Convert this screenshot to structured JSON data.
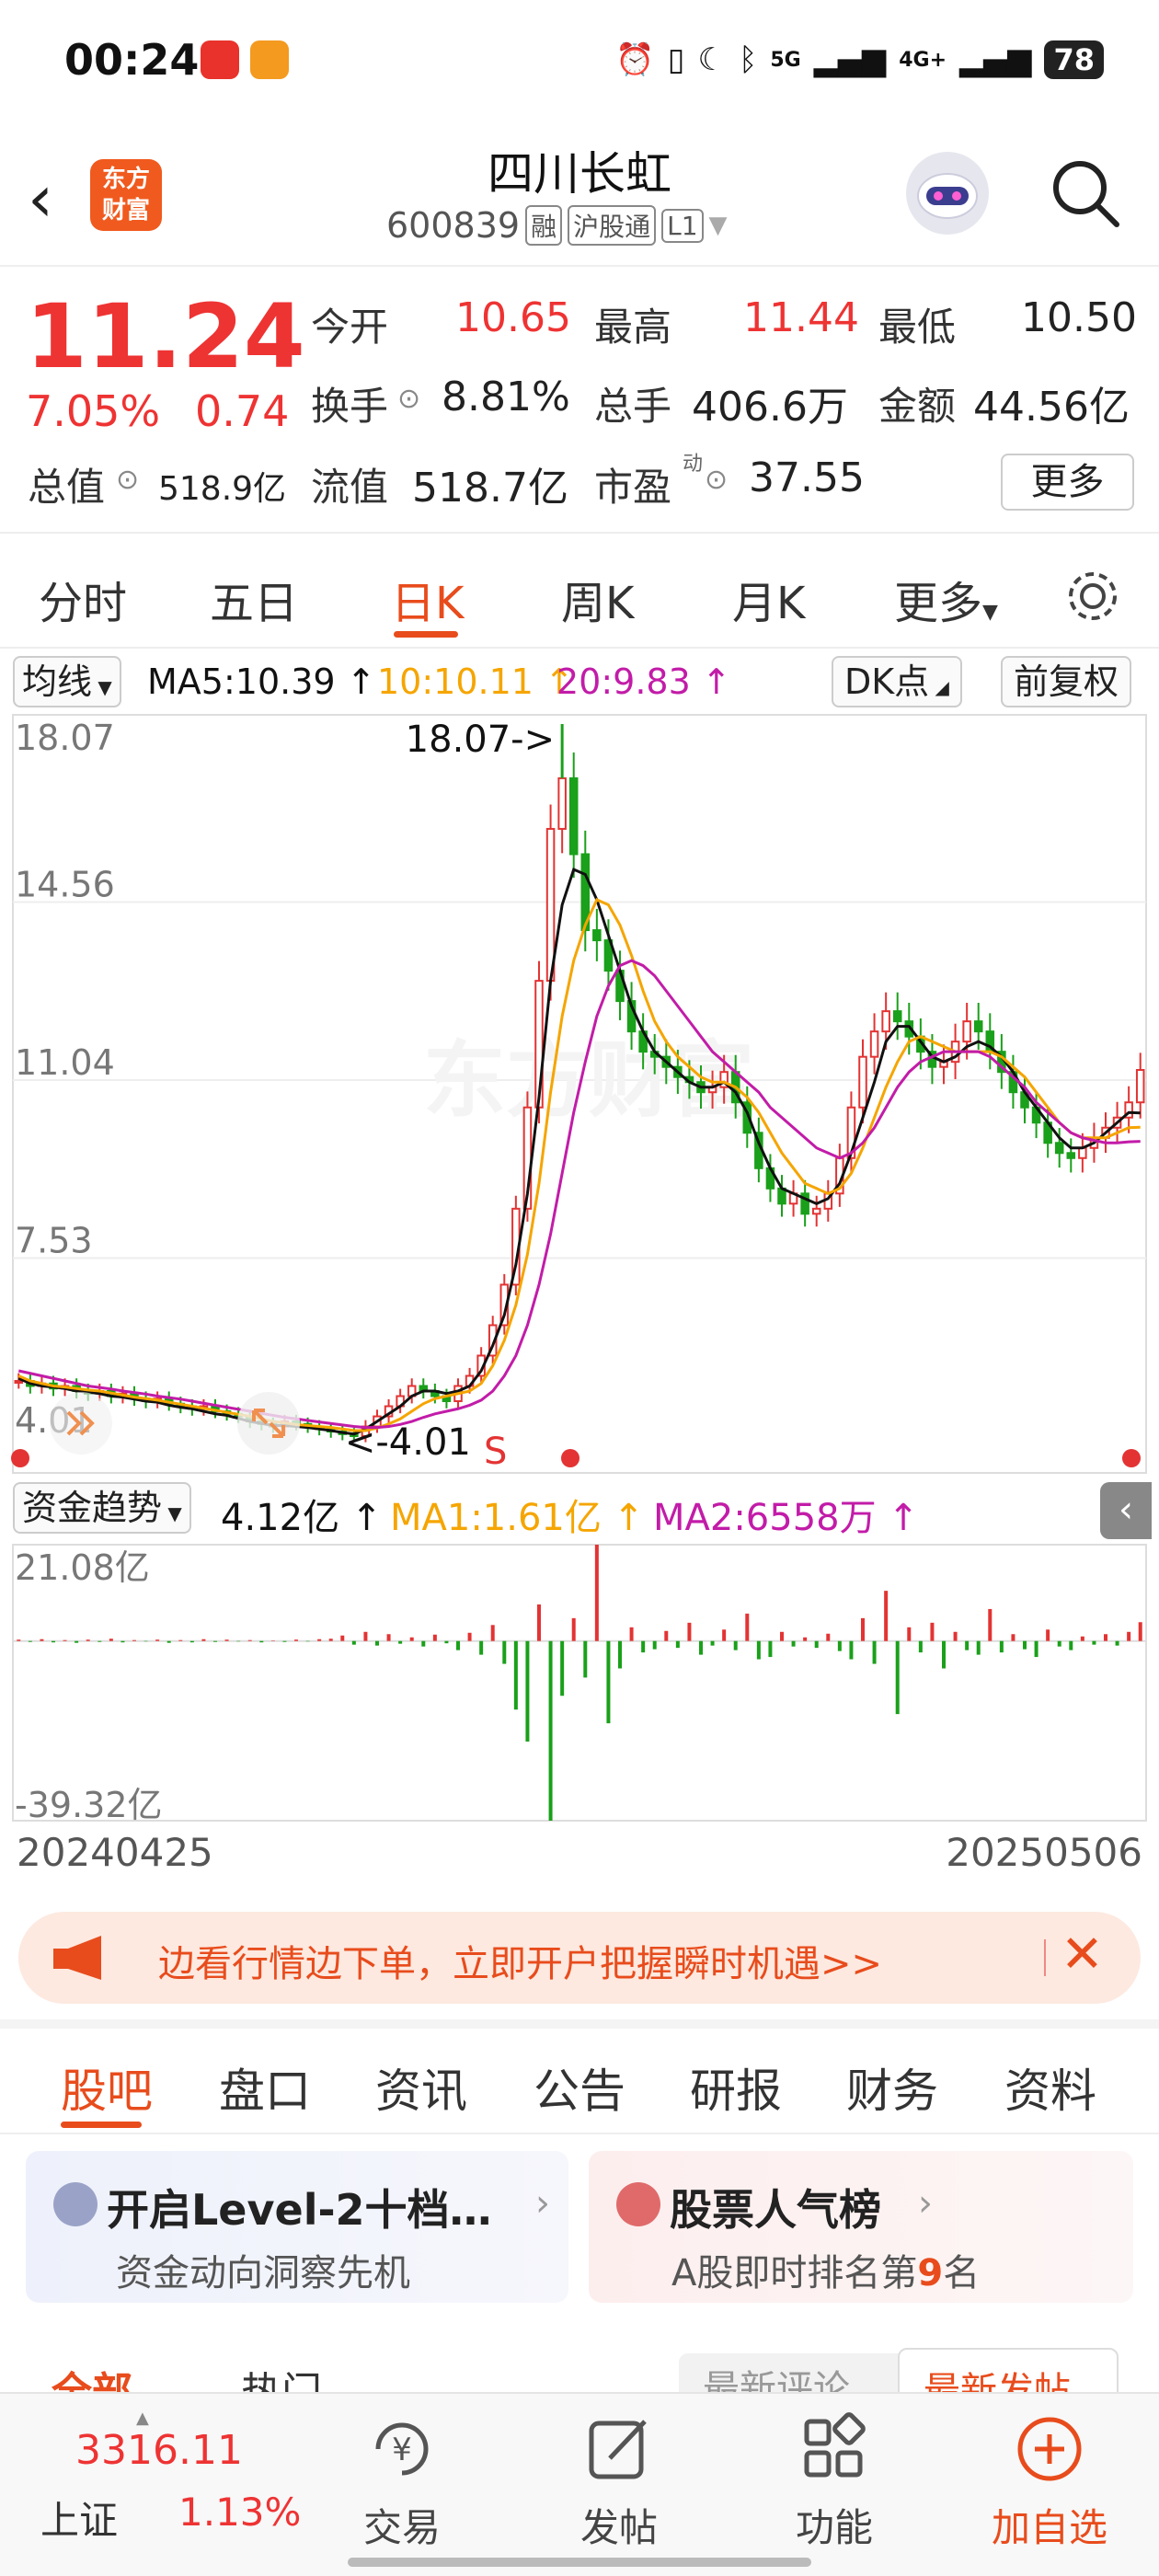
{
  "status_bar": {
    "time": "00:24",
    "network": "5G",
    "network2": "4G+",
    "battery": "78"
  },
  "header": {
    "logo_line1": "东方",
    "logo_line2": "财富",
    "stock_name": "四川长虹",
    "stock_code": "600839",
    "tags": [
      "融",
      "沪股通",
      "L1"
    ]
  },
  "quote": {
    "price": "11.24",
    "pct": "7.05%",
    "change": "0.74",
    "open_label": "今开",
    "open": "10.65",
    "high_label": "最高",
    "high": "11.44",
    "low_label": "最低",
    "low": "10.50",
    "turnover_label": "换手",
    "turnover": "8.81%",
    "volume_label": "总手",
    "volume": "406.6万",
    "amount_label": "金额",
    "amount": "44.56亿",
    "mcap_label": "总值",
    "mcap": "518.9亿",
    "float_label": "流值",
    "float": "518.7亿",
    "pe_label": "市盈",
    "pe_sup": "动",
    "pe": "37.55",
    "more_label": "更多"
  },
  "period_tabs": [
    "分时",
    "五日",
    "日K",
    "周K",
    "月K",
    "更多"
  ],
  "active_period": "日K",
  "ma_row": {
    "ma_select": "均线",
    "ma5": "MA5:10.39 ↑",
    "ma10": "10:10.11 ↑",
    "ma20": "20:9.83 ↑",
    "dk_button": "DK点",
    "adjust_button": "前复权"
  },
  "colors": {
    "accent": "#e84c1c",
    "up": "#e33333",
    "down": "#1aa01a",
    "ma5": "#111111",
    "ma10": "#f5a500",
    "ma20": "#c21ca8"
  },
  "kline": {
    "y_labels": [
      "18.07",
      "14.56",
      "11.04",
      "7.53",
      "4.01"
    ],
    "max_annotation": "18.07->",
    "min_annotation": "<-4.01",
    "signal_label": "S",
    "watermark": "东方财富"
  },
  "chart_data": {
    "type": "candlestick",
    "y_range": [
      4.01,
      18.07
    ],
    "x_range": [
      "20240425",
      "20250506"
    ],
    "close": [
      5.1,
      5.0,
      5.05,
      4.95,
      5.0,
      4.9,
      4.85,
      4.9,
      4.8,
      4.85,
      4.75,
      4.7,
      4.75,
      4.65,
      4.6,
      4.55,
      4.6,
      4.5,
      4.45,
      4.4,
      4.3,
      4.25,
      4.2,
      4.3,
      4.25,
      4.2,
      4.15,
      4.1,
      4.05,
      4.01,
      4.2,
      4.4,
      4.6,
      4.8,
      5.0,
      4.9,
      4.8,
      4.7,
      5.0,
      5.2,
      5.6,
      6.2,
      7.0,
      8.5,
      10.5,
      13.0,
      16.0,
      17.0,
      15.5,
      14.0,
      13.8,
      13.2,
      12.6,
      12.0,
      11.6,
      11.5,
      11.3,
      11.1,
      11.0,
      10.8,
      10.9,
      11.2,
      10.6,
      10.0,
      9.3,
      8.9,
      8.6,
      8.8,
      8.4,
      8.5,
      8.8,
      9.5,
      10.5,
      11.5,
      12.0,
      12.4,
      12.2,
      11.9,
      11.6,
      11.3,
      11.4,
      11.8,
      12.2,
      12.0,
      11.6,
      11.2,
      10.8,
      10.5,
      10.2,
      9.8,
      9.6,
      9.5,
      9.7,
      9.9,
      10.1,
      10.3,
      10.6,
      11.24
    ],
    "ma5": [
      5.15,
      5.05,
      5.0,
      4.98,
      4.95,
      4.9,
      4.88,
      4.85,
      4.8,
      4.78,
      4.74,
      4.7,
      4.68,
      4.62,
      4.58,
      4.55,
      4.5,
      4.45,
      4.42,
      4.36,
      4.3,
      4.26,
      4.22,
      4.22,
      4.2,
      4.18,
      4.15,
      4.12,
      4.08,
      4.05,
      4.15,
      4.3,
      4.45,
      4.6,
      4.8,
      4.9,
      4.9,
      4.85,
      4.9,
      5.0,
      5.3,
      5.8,
      6.4,
      7.4,
      8.8,
      10.7,
      13.0,
      14.5,
      15.2,
      15.1,
      14.6,
      13.9,
      13.2,
      12.5,
      12.0,
      11.6,
      11.4,
      11.2,
      11.0,
      10.9,
      10.9,
      11.0,
      10.8,
      10.4,
      9.8,
      9.3,
      8.9,
      8.8,
      8.7,
      8.6,
      8.7,
      9.0,
      9.6,
      10.3,
      11.0,
      11.8,
      12.1,
      12.1,
      11.8,
      11.5,
      11.4,
      11.5,
      11.7,
      11.8,
      11.7,
      11.5,
      11.2,
      10.8,
      10.5,
      10.2,
      9.9,
      9.7,
      9.7,
      9.8,
      10.0,
      10.2,
      10.4,
      10.39
    ],
    "ma10": [
      5.2,
      5.1,
      5.05,
      5.0,
      4.98,
      4.95,
      4.92,
      4.9,
      4.86,
      4.82,
      4.78,
      4.75,
      4.72,
      4.68,
      4.64,
      4.6,
      4.56,
      4.52,
      4.48,
      4.44,
      4.4,
      4.35,
      4.3,
      4.27,
      4.24,
      4.22,
      4.2,
      4.18,
      4.15,
      4.12,
      4.12,
      4.17,
      4.25,
      4.35,
      4.5,
      4.65,
      4.75,
      4.8,
      4.85,
      4.9,
      5.05,
      5.4,
      5.9,
      6.6,
      7.6,
      9.0,
      10.8,
      12.3,
      13.4,
      14.1,
      14.6,
      14.5,
      14.1,
      13.5,
      12.8,
      12.2,
      11.8,
      11.5,
      11.3,
      11.1,
      11.0,
      11.0,
      10.9,
      10.7,
      10.4,
      10.0,
      9.6,
      9.3,
      9.0,
      8.9,
      8.8,
      8.9,
      9.2,
      9.7,
      10.3,
      10.9,
      11.4,
      11.8,
      11.9,
      11.8,
      11.7,
      11.6,
      11.6,
      11.6,
      11.6,
      11.5,
      11.3,
      11.1,
      10.8,
      10.5,
      10.2,
      10.0,
      9.9,
      9.9,
      9.9,
      10.0,
      10.1,
      10.11
    ],
    "ma20": [
      5.3,
      5.25,
      5.2,
      5.15,
      5.1,
      5.05,
      5.0,
      4.97,
      4.94,
      4.9,
      4.87,
      4.84,
      4.8,
      4.77,
      4.74,
      4.7,
      4.66,
      4.62,
      4.58,
      4.54,
      4.5,
      4.46,
      4.42,
      4.38,
      4.35,
      4.32,
      4.29,
      4.26,
      4.23,
      4.2,
      4.18,
      4.18,
      4.2,
      4.24,
      4.3,
      4.38,
      4.45,
      4.5,
      4.55,
      4.62,
      4.72,
      4.9,
      5.2,
      5.6,
      6.2,
      7.0,
      8.0,
      9.2,
      10.4,
      11.4,
      12.3,
      12.9,
      13.3,
      13.4,
      13.3,
      13.1,
      12.8,
      12.5,
      12.2,
      11.9,
      11.6,
      11.4,
      11.2,
      11.0,
      10.8,
      10.5,
      10.3,
      10.1,
      9.9,
      9.7,
      9.6,
      9.5,
      9.6,
      9.8,
      10.1,
      10.5,
      10.9,
      11.2,
      11.4,
      11.5,
      11.6,
      11.6,
      11.6,
      11.6,
      11.5,
      11.3,
      11.1,
      10.9,
      10.6,
      10.4,
      10.2,
      10.0,
      9.9,
      9.85,
      9.8,
      9.8,
      9.82,
      9.83
    ]
  },
  "flow_row": {
    "select": "资金趋势",
    "value": "4.12亿 ↑",
    "ma1": "MA1:1.61亿 ↑",
    "ma2": "MA2:6558万 ↑"
  },
  "flow": {
    "y_top": "21.08亿",
    "y_bottom": "-39.32亿",
    "range": [
      -39.32,
      21.08
    ],
    "values": [
      0.3,
      -0.2,
      0.4,
      -0.3,
      0.2,
      -0.4,
      0.3,
      -0.2,
      0.5,
      -0.3,
      0.2,
      -0.1,
      0.3,
      -0.4,
      0.2,
      -0.3,
      0.4,
      -0.2,
      0.3,
      -0.1,
      0.2,
      -0.3,
      0.1,
      -0.2,
      0.3,
      -0.1,
      0.4,
      0.5,
      1.2,
      -0.8,
      2.0,
      -1.0,
      1.5,
      -0.6,
      0.8,
      -1.2,
      1.4,
      -0.5,
      -2.0,
      1.8,
      -3.0,
      3.5,
      -5.0,
      -15.0,
      -22.0,
      8.0,
      -39.32,
      -12.0,
      5.0,
      -8.0,
      21.08,
      -18.0,
      -6.0,
      3.0,
      -2.5,
      -1.8,
      2.2,
      -1.5,
      4.0,
      -3.0,
      -1.0,
      2.5,
      -2.0,
      6.0,
      -4.0,
      -3.5,
      2.0,
      -1.2,
      0.8,
      -1.5,
      1.6,
      -2.2,
      -4.0,
      5.0,
      -5.0,
      11.0,
      -16.0,
      3.0,
      -2.5,
      4.0,
      -6.0,
      2.0,
      -2.0,
      -3.0,
      7.0,
      -2.5,
      1.5,
      -1.8,
      -3.5,
      2.5,
      -1.2,
      -2.0,
      1.0,
      -0.8,
      1.5,
      -1.0,
      2.0,
      4.12
    ]
  },
  "date_range": {
    "start": "20240425",
    "end": "20250506"
  },
  "banner": {
    "text": "边看行情边下单，立即开户把握瞬时机遇>>"
  },
  "bottom_tabs": [
    "股吧",
    "盘口",
    "资讯",
    "公告",
    "研报",
    "财务",
    "资料"
  ],
  "cards": {
    "left_title": "开启Level-2十档…",
    "left_sub": "资金动向洞察先机",
    "right_title": "股票人气榜",
    "right_sub_pre": "A股即时排名第",
    "right_rank": "9",
    "right_sub_post": "名"
  },
  "feed_tabs": [
    "全部",
    "热门",
    "最新评论",
    "最新发帖"
  ],
  "bottom_nav": {
    "index_value": "3316.11",
    "index_name": "上证",
    "index_pct": "1.13%",
    "items": [
      "交易",
      "发帖",
      "功能",
      "加自选"
    ]
  }
}
